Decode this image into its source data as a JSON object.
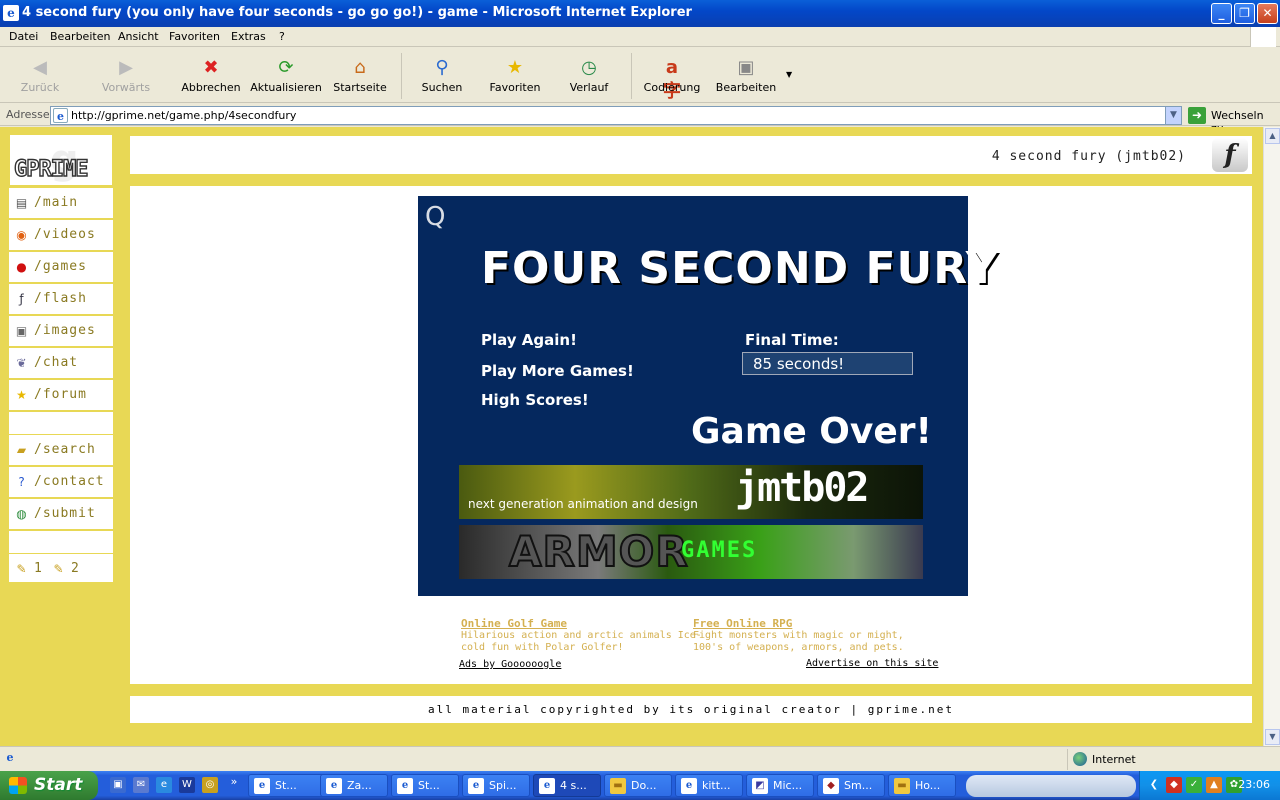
{
  "window": {
    "title": "4 second fury (you only have four seconds - go go go!) - game - Microsoft Internet Explorer",
    "buttons": [
      "minimize",
      "maximize",
      "close"
    ]
  },
  "menu": [
    "Datei",
    "Bearbeiten",
    "Ansicht",
    "Favoriten",
    "Extras",
    "?"
  ],
  "toolbar": {
    "back": "Zurück",
    "forward": "Vorwärts",
    "stop": "Abbrechen",
    "refresh": "Aktualisieren",
    "home": "Startseite",
    "search": "Suchen",
    "favorites": "Favoriten",
    "history": "Verlauf",
    "encoding": "Codierung",
    "edit": "Bearbeiten"
  },
  "address": {
    "label": "Adresse",
    "url": "http://gprime.net/game.php/4secondfury",
    "go": "Wechseln zu"
  },
  "site": {
    "logo": "GPRIME",
    "nav": [
      {
        "label": "/main",
        "icon": "page-icon"
      },
      {
        "label": "/videos",
        "icon": "media-icon"
      },
      {
        "label": "/games",
        "icon": "games-icon"
      },
      {
        "label": "/flash",
        "icon": "flash-icon"
      },
      {
        "label": "/images",
        "icon": "camera-icon"
      },
      {
        "label": "/chat",
        "icon": "chat-icon"
      },
      {
        "label": "/forum",
        "icon": "star-icon"
      }
    ],
    "nav2": [
      {
        "label": "/search",
        "icon": "folder-search-icon"
      },
      {
        "label": "/contact",
        "icon": "help-icon"
      },
      {
        "label": "/submit",
        "icon": "globe-icon"
      }
    ],
    "pages": [
      "1",
      "2"
    ],
    "header_title": "4 second fury (jmtb02)",
    "footer": "all material copyrighted by its original creator | gprime.net"
  },
  "game": {
    "quality_toggle": "Q",
    "title": "FOUR SECOND FURY",
    "menu": [
      "Play Again!",
      "Play More Games!",
      "High Scores!"
    ],
    "final_time_label": "Final Time:",
    "final_time_value": "85 seconds!",
    "game_over": "Game Over!",
    "banner1_tagline": "next generation animation and design",
    "banner1_logo": "jmtb02",
    "banner2_word1": "ARMOR",
    "banner2_word2": "GAMES"
  },
  "ads": {
    "ad1_title": "Online Golf Game",
    "ad1_line1": "Hilarious action and arctic animals Ice-",
    "ad1_line2": "cold fun with Polar Golfer!",
    "ad2_title": "Free Online RPG",
    "ad2_line1": "Fight monsters with magic or might,",
    "ad2_line2": "100's of weapons, armors, and pets.",
    "ads_by": "Ads by Goooooogle",
    "advertise": "Advertise on this site"
  },
  "status": {
    "zone": "Internet"
  },
  "taskbar": {
    "start": "Start",
    "tasks": [
      {
        "label": "St...",
        "icon": "ie-icon",
        "active": false
      },
      {
        "label": "Za...",
        "icon": "ie-icon",
        "active": false
      },
      {
        "label": "St...",
        "icon": "ie-icon",
        "active": false
      },
      {
        "label": "Spi...",
        "icon": "ie-icon",
        "active": false
      },
      {
        "label": "4 s...",
        "icon": "ie-icon",
        "active": true
      },
      {
        "label": "Do...",
        "icon": "folder-icon",
        "active": false
      },
      {
        "label": "kitt...",
        "icon": "ie-icon",
        "active": false
      },
      {
        "label": "Mic...",
        "icon": "app-icon",
        "active": false
      },
      {
        "label": "Sm...",
        "icon": "app-icon",
        "active": false
      },
      {
        "label": "Ho...",
        "icon": "folder-icon",
        "active": false
      }
    ],
    "clock": "23:06"
  }
}
